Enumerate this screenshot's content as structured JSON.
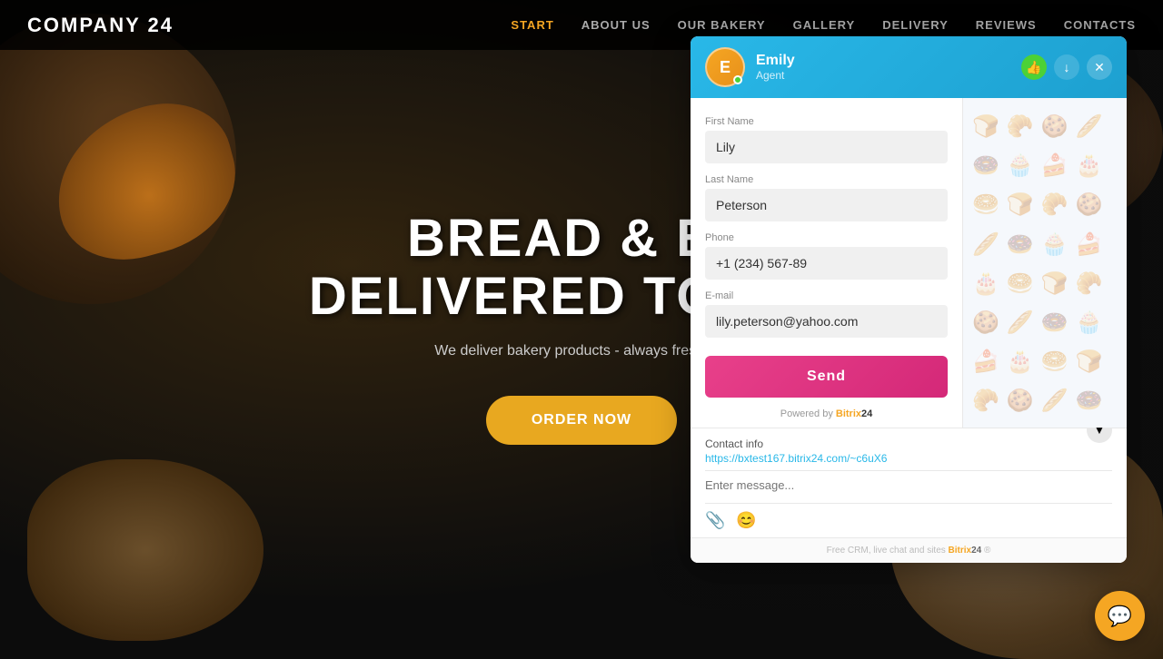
{
  "nav": {
    "logo": "COMPANY 24",
    "links": [
      {
        "label": "START",
        "active": true
      },
      {
        "label": "ABOUT US",
        "active": false
      },
      {
        "label": "OUR BAKERY",
        "active": false
      },
      {
        "label": "GALLERY",
        "active": false
      },
      {
        "label": "DELIVERY",
        "active": false
      },
      {
        "label": "REVIEWS",
        "active": false
      },
      {
        "label": "CONTACTS",
        "active": false
      }
    ]
  },
  "hero": {
    "title_line1": "BREAD & BU",
    "title_line2": "DELIVERED TO YOU",
    "subtitle": "We deliver bakery products - always fresh, rig",
    "order_button": "ORDER NOW"
  },
  "chat": {
    "agent_name": "Emily",
    "agent_role": "Agent",
    "agent_initial": "E",
    "header_like_label": "👍",
    "header_download_label": "↓",
    "header_close_label": "✕",
    "form": {
      "first_name_label": "First Name",
      "first_name_value": "Lily",
      "last_name_label": "Last Name",
      "last_name_value": "Peterson",
      "phone_label": "Phone",
      "phone_value": "+1 (234) 567-89",
      "email_label": "E-mail",
      "email_value": "lily.peterson@yahoo.com",
      "send_button": "Send",
      "powered_by": "Powered by",
      "brand_name": "Bitrix",
      "brand_num": "24"
    },
    "bottom": {
      "contact_info_label": "Contact info",
      "contact_link": "https://bxtest167.bitrix24.com/~c6uX6",
      "message_placeholder": "Enter message...",
      "footer_text": "Free CRM, live chat and sites",
      "footer_brand": "Bitrix",
      "footer_num": "24"
    }
  },
  "float_btn": {
    "icon": "💬"
  }
}
